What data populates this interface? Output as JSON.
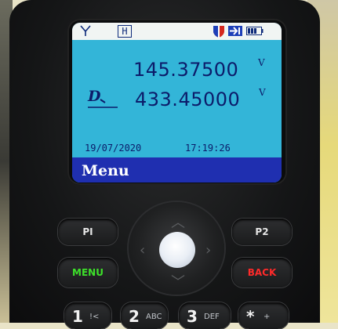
{
  "status_bar": {
    "mode_badge": "H",
    "icons": [
      "antenna-icon",
      "shield-icon",
      "arrow-icon",
      "battery-icon"
    ]
  },
  "display": {
    "frequency_a": "145.37500",
    "frequency_b": "433.45000",
    "marker_a": "V",
    "marker_b": "V",
    "date": "19/07/2020",
    "time": "17:19:26",
    "softkey": "Menu"
  },
  "keys": {
    "p1": "PI",
    "p2": "P2",
    "menu": "MENU",
    "back": "BACK",
    "k1": "1",
    "k1_sub": "!<",
    "k2": "2",
    "k2_sub": "ABC",
    "k3": "3",
    "k3_sub": "DEF",
    "kstar": "*",
    "kstar_sub": "+"
  },
  "colors": {
    "screen": "#33b5d8",
    "softkey_bar": "#1f2fb0",
    "menu_key": "#3de12a",
    "back_key": "#ff2a2a",
    "text": "#0c1c6a"
  }
}
